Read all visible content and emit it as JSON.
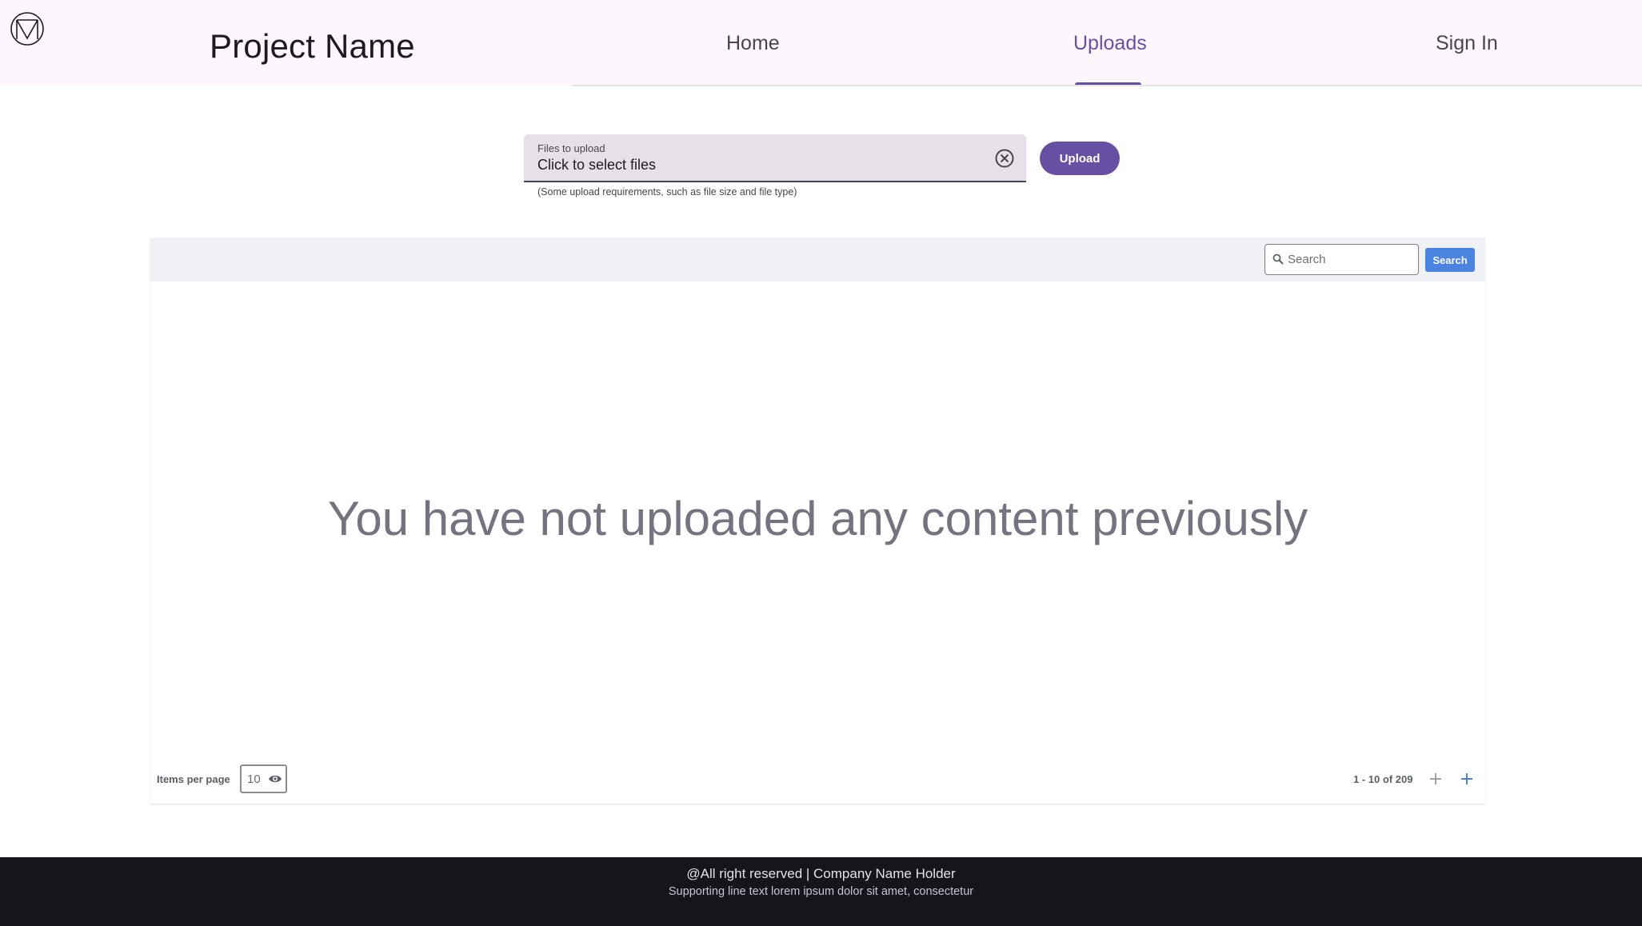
{
  "header": {
    "project_name": "Project Name",
    "nav": {
      "home": "Home",
      "uploads": "Uploads",
      "sign_in": "Sign In"
    },
    "active_nav": "Uploads"
  },
  "upload": {
    "field_label": "Files to upload",
    "field_value": "Click to select files",
    "supporting_text": "(Some upload requirements, such as file size and file type)",
    "upload_label": "Upload"
  },
  "table": {
    "search_placeholder": "Search",
    "search_button_label": "Search",
    "empty_message": "You have not uploaded any content previously",
    "items_per_page_label": "Items per page",
    "items_per_page_value": "10",
    "range_text": "1 - 10 of 209"
  },
  "footer": {
    "line1": "@All right reserved | Company Name Holder",
    "line2": "Supporting line text lorem ipsum dolor sit amet, consectetur"
  },
  "colors": {
    "primary": "#6750a4",
    "header_bg": "#fdf6fc",
    "field_bg": "#e7e0e8",
    "search_button": "#4a84e0",
    "footer_bg": "#17141c"
  }
}
